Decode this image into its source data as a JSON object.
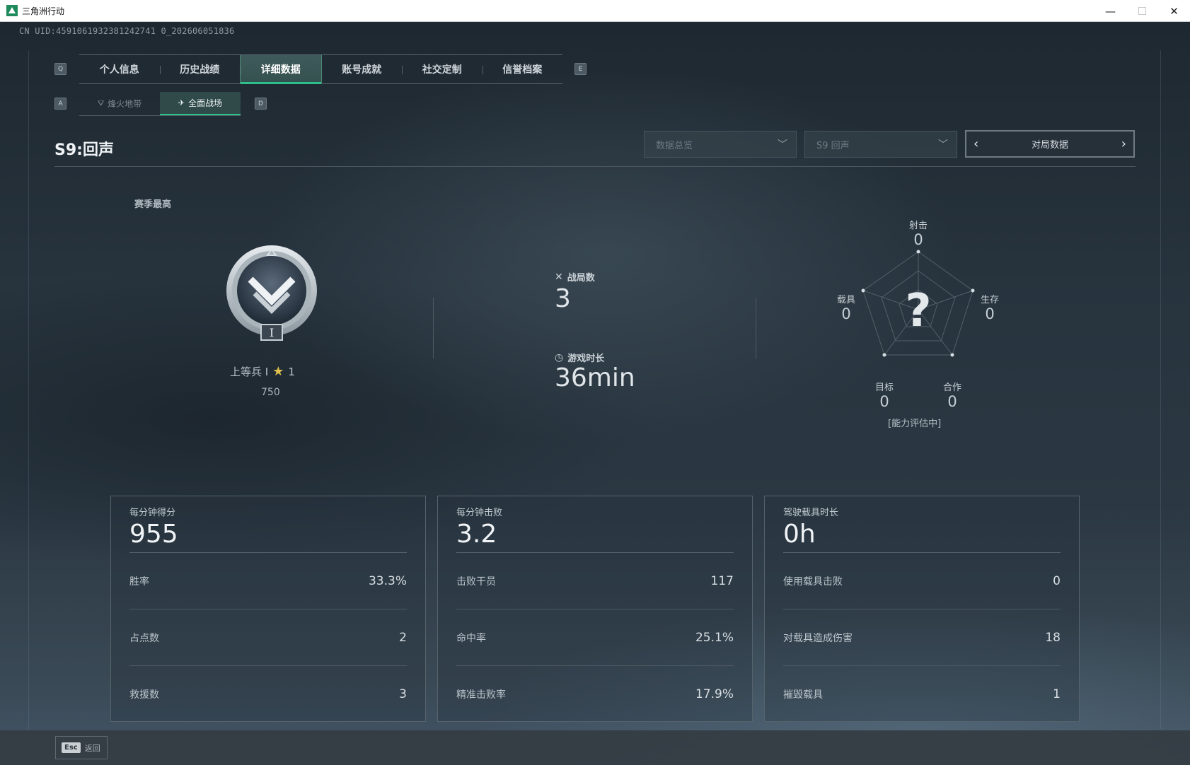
{
  "window": {
    "title": "三角洲行动",
    "minimize": "—",
    "maximize": "☐",
    "close": "✕"
  },
  "uid": "CN UID:4591061932381242741 0_202606051836",
  "tabs": {
    "left_key": "Q",
    "right_key": "E",
    "items": [
      {
        "label": "个人信息"
      },
      {
        "label": "历史战绩"
      },
      {
        "label": "详细数据",
        "active": true
      },
      {
        "label": "账号成就"
      },
      {
        "label": "社交定制"
      },
      {
        "label": "信誉档案"
      }
    ]
  },
  "subtabs": {
    "left_key": "A",
    "right_key": "D",
    "items": [
      {
        "label": "烽火地带",
        "icon": "triangle-icon"
      },
      {
        "label": "全面战场",
        "icon": "tank-icon",
        "active": true
      }
    ]
  },
  "season": {
    "title": "S9:回声",
    "filter_data": "数据总览",
    "filter_season": "S9 回声",
    "pager_label": "对局数据"
  },
  "rank": {
    "caption": "赛季最高",
    "name": "上等兵 I",
    "stars": "1",
    "points": "750",
    "emblem_numeral": "I"
  },
  "match": {
    "games_label": "战局数",
    "games_value": "3",
    "time_label": "游戏时长",
    "time_value": "36min"
  },
  "radar": {
    "center_mark": "?",
    "note": "[能力评估中]",
    "axes": [
      {
        "label": "射击",
        "value": "0"
      },
      {
        "label": "生存",
        "value": "0"
      },
      {
        "label": "合作",
        "value": "0"
      },
      {
        "label": "目标",
        "value": "0"
      },
      {
        "label": "载具",
        "value": "0"
      }
    ]
  },
  "panels": [
    {
      "title": "每分钟得分",
      "value": "955",
      "rows": [
        {
          "k": "胜率",
          "v": "33.3%"
        },
        {
          "k": "占点数",
          "v": "2"
        },
        {
          "k": "救援数",
          "v": "3"
        }
      ]
    },
    {
      "title": "每分钟击败",
      "value": "3.2",
      "rows": [
        {
          "k": "击败干员",
          "v": "117"
        },
        {
          "k": "命中率",
          "v": "25.1%"
        },
        {
          "k": "精准击败率",
          "v": "17.9%"
        }
      ]
    },
    {
      "title": "驾驶载具时长",
      "value": "0h",
      "rows": [
        {
          "k": "使用载具击败",
          "v": "0"
        },
        {
          "k": "对载具造成伤害",
          "v": "18"
        },
        {
          "k": "摧毁载具",
          "v": "1"
        }
      ]
    }
  ],
  "footer": {
    "esc_key": "Esc",
    "back_label": "返回"
  },
  "colors": {
    "accent": "#2ec08a",
    "star": "#e2c04d"
  }
}
